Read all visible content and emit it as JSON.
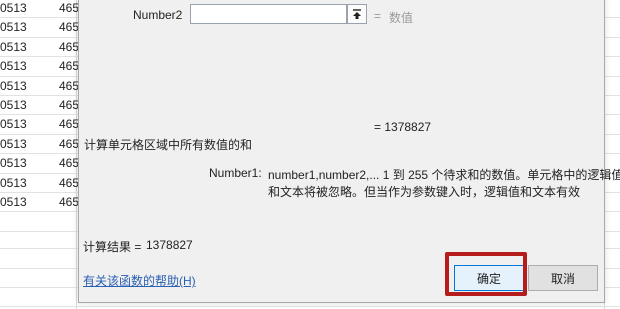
{
  "sheet": {
    "col_a_values": [
      "0513",
      "0513",
      "0513",
      "0513",
      "0513",
      "0513",
      "0513",
      "0513",
      "0513",
      "0513",
      "0513"
    ],
    "col_b_values": [
      "465",
      "465",
      "465",
      "465",
      "465",
      "465",
      "465",
      "465",
      "465",
      "465",
      "465"
    ]
  },
  "dialog": {
    "number2_label": "Number2",
    "number2_placeholder": "",
    "number2_eq": "=",
    "number2_hint": "数值",
    "formula_result_line": "=  1378827",
    "description": "计算单元格区域中所有数值的和",
    "param_name": "Number1:",
    "param_desc_line1": "number1,number2,...  1 到 255 个待求和的数值。单元格中的逻辑值",
    "param_desc_line2": "和文本将被忽略。但当作为参数键入时，逻辑值和文本有效",
    "result_label": "计算结果 =",
    "result_value": "1378827",
    "help_link": "有关该函数的帮助(H)",
    "ok_label": "确定",
    "cancel_label": "取消"
  },
  "colors": {
    "highlight_border": "#b51c1c",
    "link": "#2a5fb3",
    "primary_border": "#0078d7"
  }
}
